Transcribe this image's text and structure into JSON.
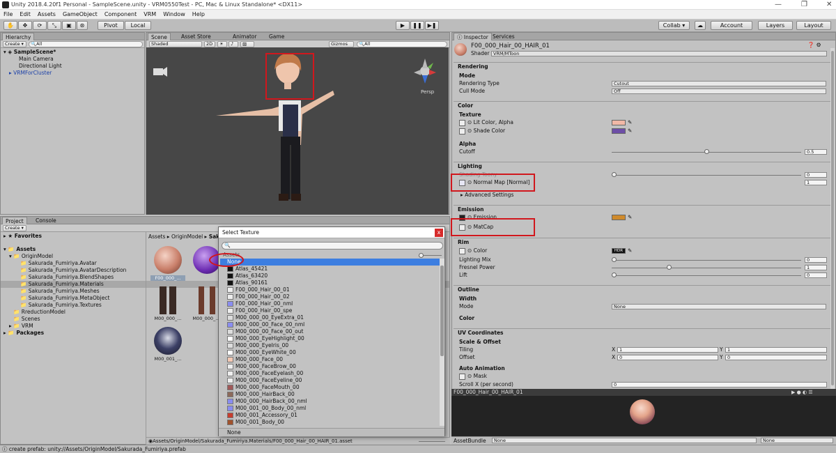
{
  "window": {
    "title": "Unity 2018.4.20f1 Personal - SampleScene.unity - VRM0550Test - PC, Mac & Linux Standalone* <DX11>",
    "min": "—",
    "max": "❐",
    "close": "✕"
  },
  "menu": [
    "File",
    "Edit",
    "Assets",
    "GameObject",
    "Component",
    "VRM",
    "Window",
    "Help"
  ],
  "toolbar": {
    "pivot": "Pivot",
    "local": "Local",
    "collab": "Collab ▾",
    "account": "Account",
    "layers": "Layers",
    "layout": "Layout"
  },
  "hierarchy": {
    "tab": "Hierarchy",
    "create": "Create ▾",
    "search_placeholder": "All",
    "scene": "SampleScene*",
    "items": [
      "Main Camera",
      "Directional Light",
      "VRMForCluster"
    ]
  },
  "scene_view": {
    "tabs": [
      "Scene",
      "Asset Store",
      "Animator",
      "Game"
    ],
    "shading": "Shaded",
    "mode2d": "2D",
    "gizmos": "Gizmos",
    "search_placeholder": "All",
    "persp": "Persp"
  },
  "project": {
    "tabs": [
      "Project",
      "Console"
    ],
    "create": "Create ▾",
    "favorites": "Favorites",
    "assets": "Assets",
    "origin": "OriginModel",
    "tree": [
      "Sakurada_Fumiriya.Avatar",
      "Sakurada_Fumiriya.AvatarDescription",
      "Sakurada_Fumiriya.BlendShapes",
      "Sakurada_Fumiriya.Materials",
      "Sakurada_Fumiriya.Meshes",
      "Sakurada_Fumiriya.MetaObject",
      "Sakurada_Fumiriya.Textures"
    ],
    "tree2": [
      "RreductionModel",
      "Scenes",
      "VRM"
    ],
    "packages": "Packages",
    "breadcrumb": [
      "Assets",
      "OriginModel",
      "Sak"
    ],
    "thumbs": [
      "F00_000_...",
      "",
      "M00_000_...",
      "M00_000_...",
      "M00_001_..."
    ],
    "path": "Assets/OriginModel/Sakurada_Fumiriya.Materials/F00_000_Hair_00_HAIR_01.asset"
  },
  "dialog": {
    "title": "Select Texture",
    "close": "x",
    "section": "Assets",
    "items": [
      "None",
      "Atlas_45421",
      "Atlas_63420",
      "Atlas_90161",
      "F00_000_Hair_00_01",
      "F00_000_Hair_00_02",
      "F00_000_Hair_00_nml",
      "F00_000_Hair_00_spe",
      "M00_000_00_EyeExtra_01",
      "M00_000_00_Face_00_nml",
      "M00_000_00_Face_00_out",
      "M00_000_EyeHighlight_00",
      "M00_000_EyeIris_00",
      "M00_000_EyeWhite_00",
      "M00_000_Face_00",
      "M00_000_FaceBrow_00",
      "M00_000_FaceEyelash_00",
      "M00_000_FaceEyeline_00",
      "M00_000_FaceMouth_00",
      "M00_000_HairBack_00",
      "M00_000_HairBack_00_nml",
      "M00_001_00_Body_00_nml",
      "M00_001_Accessory_01",
      "M00_001_Body_00"
    ],
    "footer": "None"
  },
  "inspector": {
    "tabs": [
      "Inspector",
      "Services"
    ],
    "material": "F00_000_Hair_00_HAIR_01",
    "shader_label": "Shader",
    "shader": "VRM/MToon",
    "rendering": {
      "header": "Rendering",
      "mode": "Mode",
      "rt_label": "Rendering Type",
      "rt": "Cutout",
      "cull_label": "Cull Mode",
      "cull": "Off"
    },
    "color": {
      "header": "Color",
      "texture": "Texture",
      "lit": "Lit Color, Alpha",
      "shade": "Shade Color",
      "lit_hex": "#f1b8a6",
      "shade_hex": "#6d4ea7"
    },
    "alpha": {
      "label": "Alpha",
      "cutoff": "Cutoff",
      "value": "0.5",
      "level": 0.5
    },
    "lighting": {
      "header": "Lighting",
      "toony": "Shading Toony",
      "toony_value": "0",
      "normal": "Normal Map [Normal]",
      "normal_value": "1",
      "advanced": "Advanced Settings"
    },
    "emission": {
      "header": "Emission",
      "emission": "Emission",
      "matcap": "MatCap",
      "hex": "#cf8a2c"
    },
    "rim": {
      "header": "Rim",
      "color": "Color",
      "hdr": "HDR",
      "mix": "Lighting Mix",
      "mix_value": "0",
      "fresnel": "Fresnel Power",
      "fresnel_value": "1",
      "fresnel_level": 0.3,
      "lift": "Lift",
      "lift_value": "0"
    },
    "outline": {
      "header": "Outline",
      "width": "Width",
      "mode_label": "Mode",
      "mode": "None",
      "color": "Color"
    },
    "uv": {
      "header": "UV Coordinates",
      "scale": "Scale & Offset",
      "tiling": "Tiling",
      "offset": "Offset",
      "x": "X",
      "y": "Y",
      "tx": "1",
      "ty": "1",
      "ox": "0",
      "oy": "0",
      "auto": "Auto Animation",
      "mask": "Mask",
      "scroll": "Scroll X (per second)",
      "scroll_value": "0"
    },
    "preview_title": "F00_000_Hair_00_HAIR_01",
    "assetbundle": "AssetBundle",
    "ab1": "None",
    "ab2": "None"
  },
  "status": "create prefab: unity://Assets/OriginModel/Sakurada_Fumiriya.prefab"
}
